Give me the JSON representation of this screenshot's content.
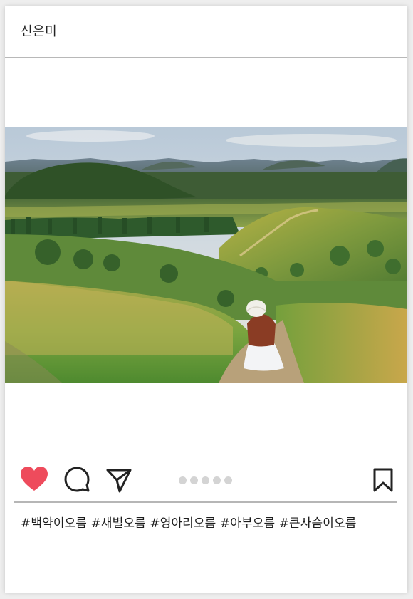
{
  "post": {
    "username": "신은미",
    "image_description": "",
    "carousel": {
      "total": 5,
      "active": 0
    },
    "caption": "#백약이오름 #새별오름 #영아리오름 #아부오름 #큰사슴이오름"
  },
  "icons": {
    "like": "heart-icon",
    "comment": "speech-bubble-icon",
    "share": "paper-plane-icon",
    "bookmark": "bookmark-icon"
  },
  "colors": {
    "like": "#ee4b5c",
    "icon_stroke": "#222222",
    "dot_inactive": "#d4d4d4",
    "divider": "#b6b6b6"
  }
}
